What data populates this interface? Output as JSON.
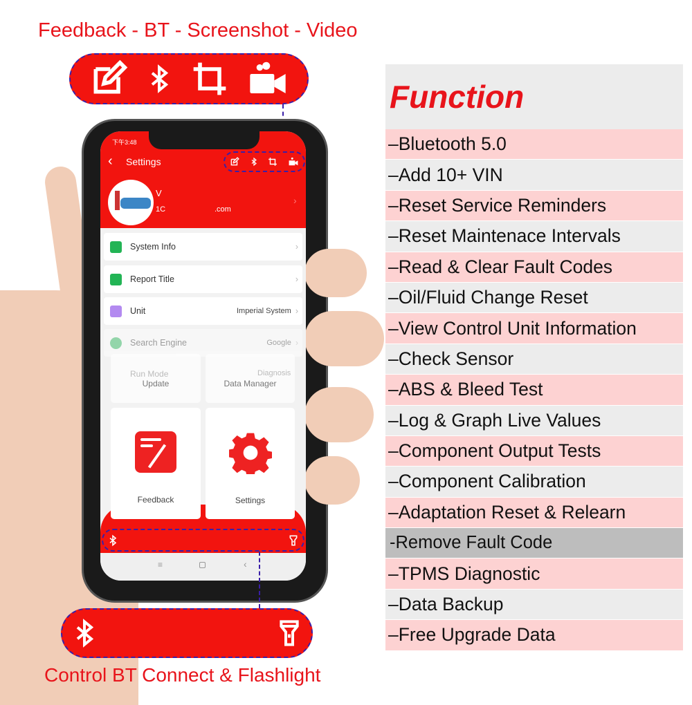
{
  "top_caption": "Feedback - BT - Screenshot - Video",
  "bottom_caption": "Control BT Connect & Flashlight",
  "top_icons": [
    "edit-icon",
    "bluetooth-icon",
    "crop-icon",
    "video-camera-icon"
  ],
  "bottom_icons": [
    "bluetooth-icon",
    "flashlight-icon"
  ],
  "phone": {
    "status_time": "下午3:48",
    "header_title": "Settings",
    "profile": {
      "name_partial": "V",
      "email_partial_start": "1C",
      "email_partial_end": ".com"
    },
    "settings": [
      {
        "label": "System Info",
        "value": "",
        "icon_color": "#22b455"
      },
      {
        "label": "Report Title",
        "value": "",
        "icon_color": "#22b455"
      },
      {
        "label": "Unit",
        "value": "Imperial System",
        "icon_color": "#b38af0"
      },
      {
        "label": "Search Engine",
        "value": "Google",
        "icon_color": "#22b455"
      },
      {
        "label": "Run Mode",
        "value": "Diagnosis",
        "icon_color": "#6b8fe0"
      }
    ],
    "cards": [
      {
        "label": "Update"
      },
      {
        "label": "Data Manager"
      },
      {
        "label": "Feedback"
      },
      {
        "label": "Settings"
      }
    ],
    "nav": [
      "menu-icon",
      "home-icon",
      "back-icon"
    ]
  },
  "function_panel": {
    "title": "Function",
    "items": [
      "–Bluetooth 5.0",
      "–Add 10+ VIN",
      "–Reset Service Reminders",
      "–Reset Maintenace Intervals",
      "–Read & Clear Fault Codes",
      "–Oil/Fluid Change Reset",
      "–View Control Unit Information",
      "–Check Sensor",
      "–ABS & Bleed Test",
      "–Log & Graph Live Values",
      "–Component Output Tests",
      "–Component Calibration",
      "–Adaptation Reset & Relearn",
      "-Remove Fault Code",
      "–TPMS Diagnostic",
      "–Data Backup",
      "–Free Upgrade Data"
    ],
    "highlighted_item": "-Remove Fault Code"
  },
  "colors": {
    "brand_red": "#f2140f",
    "row_pink": "#fdd2d2",
    "row_gray": "#ececec",
    "dashed_outline": "#3a1fa8"
  }
}
